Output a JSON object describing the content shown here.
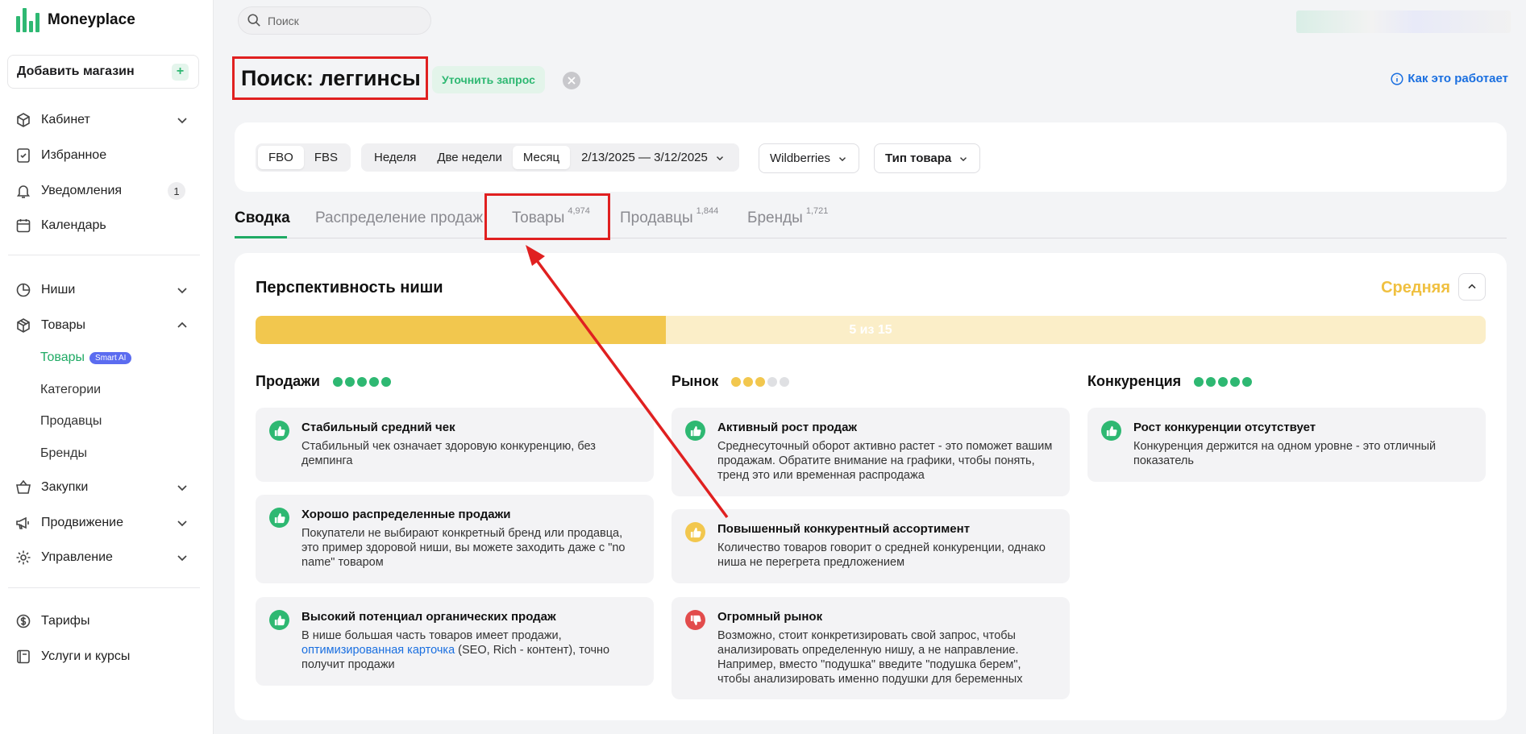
{
  "app": {
    "name": "Moneyplace"
  },
  "sidebar": {
    "add_shop": "Добавить магазин",
    "group1": [
      {
        "label": "Кабинет",
        "icon": "cube-icon",
        "chevron": "down"
      },
      {
        "label": "Избранное",
        "icon": "bookmark-icon"
      },
      {
        "label": "Уведомления",
        "icon": "bell-icon",
        "badge": "1"
      },
      {
        "label": "Календарь",
        "icon": "calendar-icon"
      }
    ],
    "group2": [
      {
        "label": "Ниши",
        "icon": "pie-chart-icon",
        "chevron": "down"
      },
      {
        "label": "Товары",
        "icon": "box-icon",
        "chevron": "up"
      }
    ],
    "products_sub": [
      {
        "label": "Товары",
        "badge": "Smart AI",
        "active": true
      },
      {
        "label": "Категории"
      },
      {
        "label": "Продавцы"
      },
      {
        "label": "Бренды"
      }
    ],
    "group3": [
      {
        "label": "Закупки",
        "icon": "basket-icon",
        "chevron": "down"
      },
      {
        "label": "Продвижение",
        "icon": "megaphone-icon",
        "chevron": "down"
      },
      {
        "label": "Управление",
        "icon": "gear-icon",
        "chevron": "down"
      }
    ],
    "group4": [
      {
        "label": "Тарифы",
        "icon": "dollar-icon"
      },
      {
        "label": "Услуги и курсы",
        "icon": "book-icon"
      }
    ]
  },
  "search": {
    "placeholder": "Поиск"
  },
  "header": {
    "title": "Поиск: леггинсы",
    "refine_label": "Уточнить запрос",
    "how_it_works": "Как это работает"
  },
  "filters": {
    "fulfillment": [
      "FBO",
      "FBS"
    ],
    "period": [
      "Неделя",
      "Две недели",
      "Месяц"
    ],
    "period_selected": "Месяц",
    "date_range": "2/13/2025 — 3/12/2025",
    "marketplace": "Wildberries",
    "product_type": "Тип товара"
  },
  "tabs": [
    {
      "label": "Сводка",
      "count": ""
    },
    {
      "label": "Распределение продаж",
      "count": ""
    },
    {
      "label": "Товары",
      "count": "4,974"
    },
    {
      "label": "Продавцы",
      "count": "1,844"
    },
    {
      "label": "Бренды",
      "count": "1,721"
    }
  ],
  "niche": {
    "title": "Перспективность ниши",
    "level": "Средняя",
    "score": 5,
    "max": 15,
    "score_text": "5 из 15",
    "colors": {
      "green": "#2eb872",
      "yellow": "#f2c74e",
      "red": "#e24c4c"
    },
    "columns": [
      {
        "title": "Продажи",
        "rating": 5,
        "dot_color": "green",
        "facts": [
          {
            "type": "good",
            "title": "Стабильный средний чек",
            "desc": "Стабильный чек означает здоровую конкуренцию, без демпинга"
          },
          {
            "type": "good",
            "title": "Хорошо распределенные продажи",
            "desc": "Покупатели не выбирают конкретный бренд или продавца, это пример здоровой ниши, вы можете заходить даже с \"no name\" товаром"
          },
          {
            "type": "good",
            "title": "Высокий потенциал органических продаж",
            "desc_pre": "В нише большая часть товаров имеет продажи, ",
            "desc_link": "оптимизированная карточка",
            "desc_post": " (SEO, Rich - контент), точно получит продажи"
          }
        ]
      },
      {
        "title": "Рынок",
        "rating": 3,
        "dot_color": "yellow",
        "facts": [
          {
            "type": "good",
            "title": "Активный рост продаж",
            "desc": "Среднесуточный оборот активно растет - это поможет вашим продажам. Обратите внимание на графики, чтобы понять, тренд это или временная распродажа"
          },
          {
            "type": "neutral",
            "title": "Повышенный конкурентный ассортимент",
            "desc": "Количество товаров говорит о средней конкуренции, однако ниша не перегрета предложением"
          },
          {
            "type": "bad",
            "title": "Огромный рынок",
            "desc": "Возможно, стоит конкретизировать свой запрос, чтобы анализировать определенную нишу, а не направление. Например, вместо \"подушка\" введите \"подушка берем\", чтобы анализировать именно подушки для беременных"
          }
        ]
      },
      {
        "title": "Конкуренция",
        "rating": 5,
        "dot_color": "green",
        "facts": [
          {
            "type": "good",
            "title": "Рост конкуренции отсутствует",
            "desc": "Конкуренция держится на одном уровне - это отличный показатель"
          }
        ]
      }
    ]
  }
}
